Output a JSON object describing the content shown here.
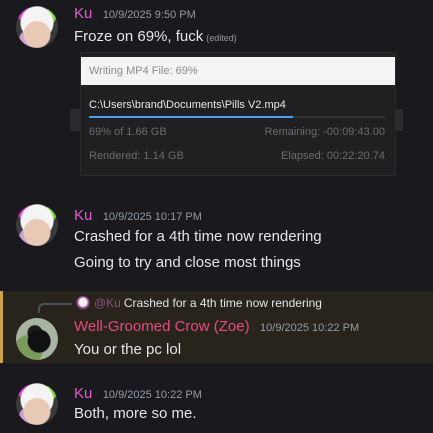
{
  "messages": [
    {
      "author": "Ku",
      "timestamp": "10/9/2025 9:50 PM",
      "lines": [
        "Froze on 69%, fuck"
      ],
      "edited_label": "(edited)",
      "attachment": {
        "window_title": "Writing MP4 File: 69%",
        "path": "C:\\Users\\brand\\Documents\\Pills V2.mp4",
        "progress_fraction": 0.69,
        "progress_text": "69% of 1.66 GB",
        "remaining_text": "Remaining: -00:09:43.00",
        "rendered_text": "Rendered: 1.14 GB",
        "elapsed_text": "Elapsed: 00:22:20.74"
      }
    },
    {
      "author": "Ku",
      "timestamp": "10/9/2025 10:17 PM",
      "lines": [
        "Crashed for a 4th time now rendering",
        "Going to try and close most things"
      ]
    },
    {
      "reply": {
        "mention": "@Ku",
        "quoted_text": "Crashed for a 4th time now rendering"
      },
      "author": "Well-Groomed Crow (Zoe)",
      "timestamp": "10/9/2025 10:22 PM",
      "lines": [
        "You or the pc lol"
      ]
    },
    {
      "author": "Ku",
      "timestamp": "10/9/2025 10:22 PM",
      "lines": [
        "Both, more so me."
      ]
    }
  ],
  "colors": {
    "background": "#1a1a1e",
    "ku_name": "#e25ad1",
    "crow_name": "#e9487f",
    "mention_highlight": "#c9a24a",
    "progress_accent": "#4d9ff0"
  }
}
